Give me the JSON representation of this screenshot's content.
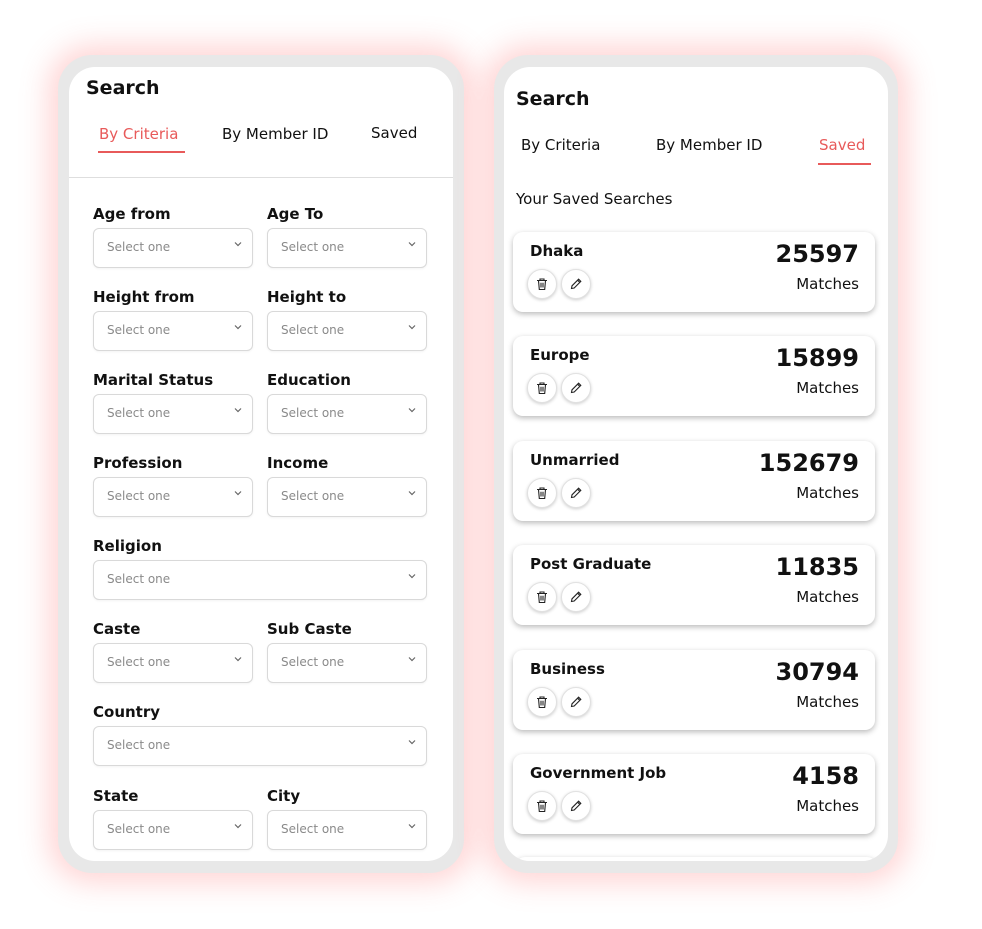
{
  "criteria_screen": {
    "title": "Search",
    "tabs": [
      {
        "label": "By Criteria",
        "active": true
      },
      {
        "label": "By Member ID",
        "active": false
      },
      {
        "label": "Saved",
        "active": false
      }
    ],
    "fields": [
      {
        "label": "Age from",
        "placeholder": "Select one"
      },
      {
        "label": "Age To",
        "placeholder": "Select one"
      },
      {
        "label": "Height from",
        "placeholder": "Select one"
      },
      {
        "label": "Height to",
        "placeholder": "Select one"
      },
      {
        "label": "Marital Status",
        "placeholder": "Select one"
      },
      {
        "label": "Education",
        "placeholder": "Select one"
      },
      {
        "label": "Profession",
        "placeholder": "Select one"
      },
      {
        "label": "Income",
        "placeholder": "Select one"
      },
      {
        "label": "Religion",
        "placeholder": "Select one"
      },
      {
        "label": "Caste",
        "placeholder": "Select one"
      },
      {
        "label": "Sub Caste",
        "placeholder": "Select one"
      },
      {
        "label": "Country",
        "placeholder": "Select one"
      },
      {
        "label": "State",
        "placeholder": "Select one"
      },
      {
        "label": "City",
        "placeholder": "Select one"
      }
    ]
  },
  "saved_screen": {
    "title": "Search",
    "tabs": [
      {
        "label": "By Criteria",
        "active": false
      },
      {
        "label": "By Member ID",
        "active": false
      },
      {
        "label": "Saved",
        "active": true
      }
    ],
    "section_label": "Your Saved Searches",
    "searches": [
      {
        "name": "Dhaka",
        "count": "25597",
        "unit": "Matches"
      },
      {
        "name": "Europe",
        "count": "15899",
        "unit": "Matches"
      },
      {
        "name": "Unmarried",
        "count": "152679",
        "unit": "Matches"
      },
      {
        "name": "Post Graduate",
        "count": "11835",
        "unit": "Matches"
      },
      {
        "name": "Business",
        "count": "30794",
        "unit": "Matches"
      },
      {
        "name": "Government Job",
        "count": "4158",
        "unit": "Matches"
      }
    ]
  },
  "colors": {
    "accent": "#e85a5a",
    "phone_frame": "#e8e8e8",
    "glow": "#ff7878"
  },
  "icons": {
    "delete": "trash-icon",
    "edit": "pencil-icon",
    "dropdown": "chevron-down-icon"
  }
}
